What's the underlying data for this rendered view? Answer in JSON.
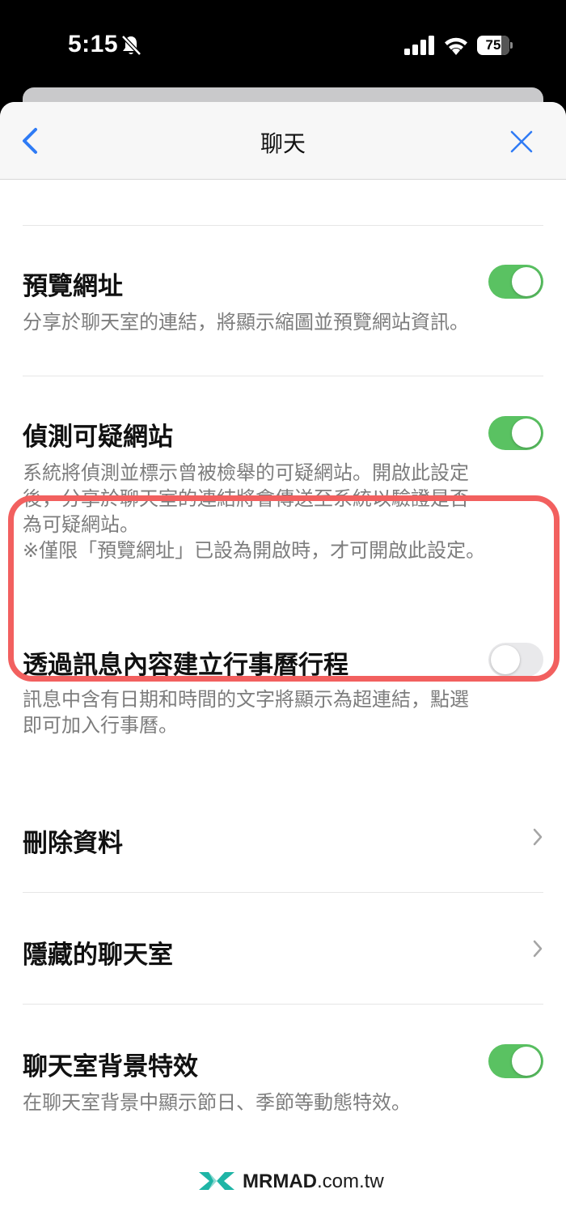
{
  "status_bar": {
    "time": "5:15",
    "battery": "75",
    "battery_level": 0.75
  },
  "nav": {
    "title": "聊天"
  },
  "settings": {
    "preview_url": {
      "title": "預覽網址",
      "desc": "分享於聊天室的連結，將顯示縮圖並預覽網站資訊。",
      "enabled": true
    },
    "suspicious_sites": {
      "title": "偵測可疑網站",
      "desc_line1": "系統將偵測並標示曾被檢舉的可疑網站。開啟此設定",
      "desc_line2": "後，分享於聊天室的連結將會傳送至系統以驗證是否",
      "desc_line3": "為可疑網站。",
      "desc_line4": "※僅限「預覽網址」已設為開啟時，才可開啟此設定。",
      "enabled": true
    },
    "calendar_events": {
      "title": "透過訊息內容建立行事曆行程",
      "desc_line1": "訊息中含有日期和時間的文字將顯示為超連結，點選",
      "desc_line2": "即可加入行事曆。",
      "enabled": false
    },
    "delete_data": {
      "title": "刪除資料"
    },
    "hidden_chats": {
      "title": "隱藏的聊天室"
    },
    "background_effects": {
      "title": "聊天室背景特效",
      "desc": "在聊天室背景中顯示節日、季節等動態特效。",
      "enabled": true
    }
  },
  "watermark": {
    "brand": "MRMAD",
    "domain": ".com.tw"
  },
  "colors": {
    "toggle_on": "#5ac262",
    "toggle_off": "#e9e9eb",
    "accent_blue": "#2f7bf5",
    "highlight_red": "#f2605f",
    "logo_teal": "#1fb5a6"
  },
  "icons": [
    "bell-slash-icon",
    "signal-icon",
    "wifi-icon",
    "back-chevron-icon",
    "close-icon",
    "chevron-right-icon"
  ]
}
